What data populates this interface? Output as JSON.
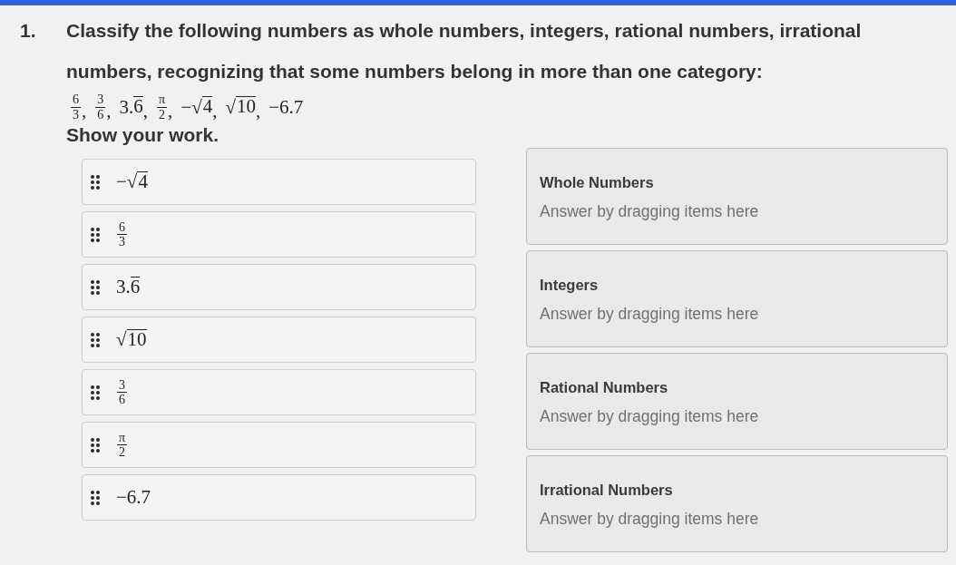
{
  "question": {
    "number": "1.",
    "text": "Classify the following numbers as whole numbers, integers, rational numbers, irrational numbers, recognizing that some numbers belong in more than one category:",
    "numbers": [
      {
        "kind": "fraction",
        "numerator": "6",
        "denominator": "3"
      },
      {
        "kind": "fraction",
        "numerator": "3",
        "denominator": "6"
      },
      {
        "kind": "repeating",
        "prefix": "3.",
        "repetend": "6"
      },
      {
        "kind": "fraction",
        "numerator": "π",
        "denominator": "2"
      },
      {
        "kind": "root",
        "prefix": "−√",
        "radicand": "4"
      },
      {
        "kind": "root",
        "prefix": "√",
        "radicand": "10"
      },
      {
        "kind": "plain",
        "text": "−6.7"
      }
    ],
    "separator": ",",
    "instruction": "Show your work."
  },
  "items": [
    {
      "kind": "root",
      "prefix": "−√",
      "radicand": "4"
    },
    {
      "kind": "fraction",
      "numerator": "6",
      "denominator": "3"
    },
    {
      "kind": "repeating",
      "prefix": "3.",
      "repetend": "6"
    },
    {
      "kind": "root",
      "prefix": "√",
      "radicand": "10"
    },
    {
      "kind": "fraction",
      "numerator": "3",
      "denominator": "6"
    },
    {
      "kind": "fraction",
      "numerator": "π",
      "denominator": "2"
    },
    {
      "kind": "plain",
      "text": "−6.7"
    }
  ],
  "categories": [
    {
      "title": "Whole Numbers",
      "placeholder": "Answer by dragging items here"
    },
    {
      "title": "Integers",
      "placeholder": "Answer by dragging items here"
    },
    {
      "title": "Rational Numbers",
      "placeholder": "Answer by dragging items here"
    },
    {
      "title": "Irrational Numbers",
      "placeholder": "Answer by dragging items here"
    }
  ]
}
